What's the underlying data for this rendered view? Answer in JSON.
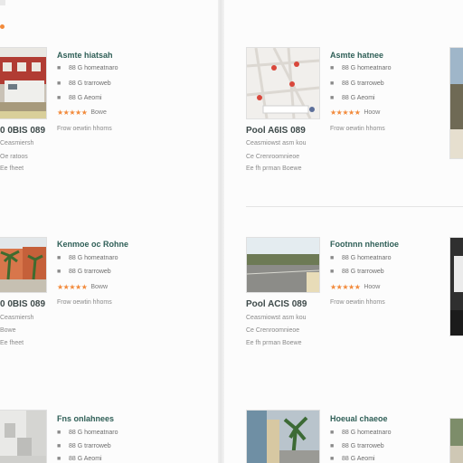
{
  "colors": {
    "title": "#2f5f57",
    "star": "#f28a3b",
    "text": "#6d6d6d"
  },
  "cards": [
    {
      "title": "Asmte hiatsah",
      "info": [
        "88 G homeatnaro",
        "88 G trarroweb",
        "88 G Aeomi"
      ],
      "rating_text": "Bowe",
      "amenity": "Frow oewtin hhoms",
      "price": "0 0BIS 089",
      "meta": [
        "Ceasmiersh",
        "Oe ratoos",
        "Ee fheet"
      ],
      "thumb_icon": "street-rv-photo"
    },
    {
      "title": "Asmte hatnee",
      "info": [
        "88 G homeatnaro",
        "88 G trarroweb",
        "88 G Aeomi"
      ],
      "rating_text": "Hoow",
      "amenity": "Frow oewtin hhoms",
      "price": "Pool A6IS 089",
      "meta": [
        "Ceasmiowst asm kou",
        "Ce Crenroomnieoe",
        "Ee fh prman Boewe"
      ],
      "thumb_icon": "map-photo"
    },
    {
      "title": "Kenmoe oc Rohne",
      "info": [
        "88 G homeatnaro",
        "88 G trarroweb",
        "88 G Aeomi"
      ],
      "rating_text": "Boww",
      "amenity": "Frow oewtin hhoms",
      "price": "0 0BIS 089",
      "meta": [
        "Ceasmiersh",
        "Bowe",
        "Ee fheet"
      ],
      "thumb_icon": "building-palm-photo"
    },
    {
      "title": "Footnnn nhentioe",
      "info": [
        "88 G homeatnaro",
        "88 G trarroweb",
        "88 G Aeomi"
      ],
      "rating_text": "Hoow",
      "amenity": "Frow oewtin hhoms",
      "price": "Pool ACIS 089",
      "meta": [
        "Ceasmiowst asm kou",
        "Ce Crenroomnieoe",
        "Ee fh prman Boewe"
      ],
      "thumb_icon": "road-photo"
    },
    {
      "title": "Fns onlahnees",
      "info": [
        "88 G homeatnaro",
        "88 G trarroweb",
        "88 G Aeomi"
      ],
      "thumb_icon": "interior-photo"
    },
    {
      "title": "Hoeual chaeoe",
      "info": [
        "88 G homeatnaro",
        "88 G trarroweb",
        "88 G Aeomi"
      ],
      "thumb_icon": "street-trees-photo"
    }
  ]
}
